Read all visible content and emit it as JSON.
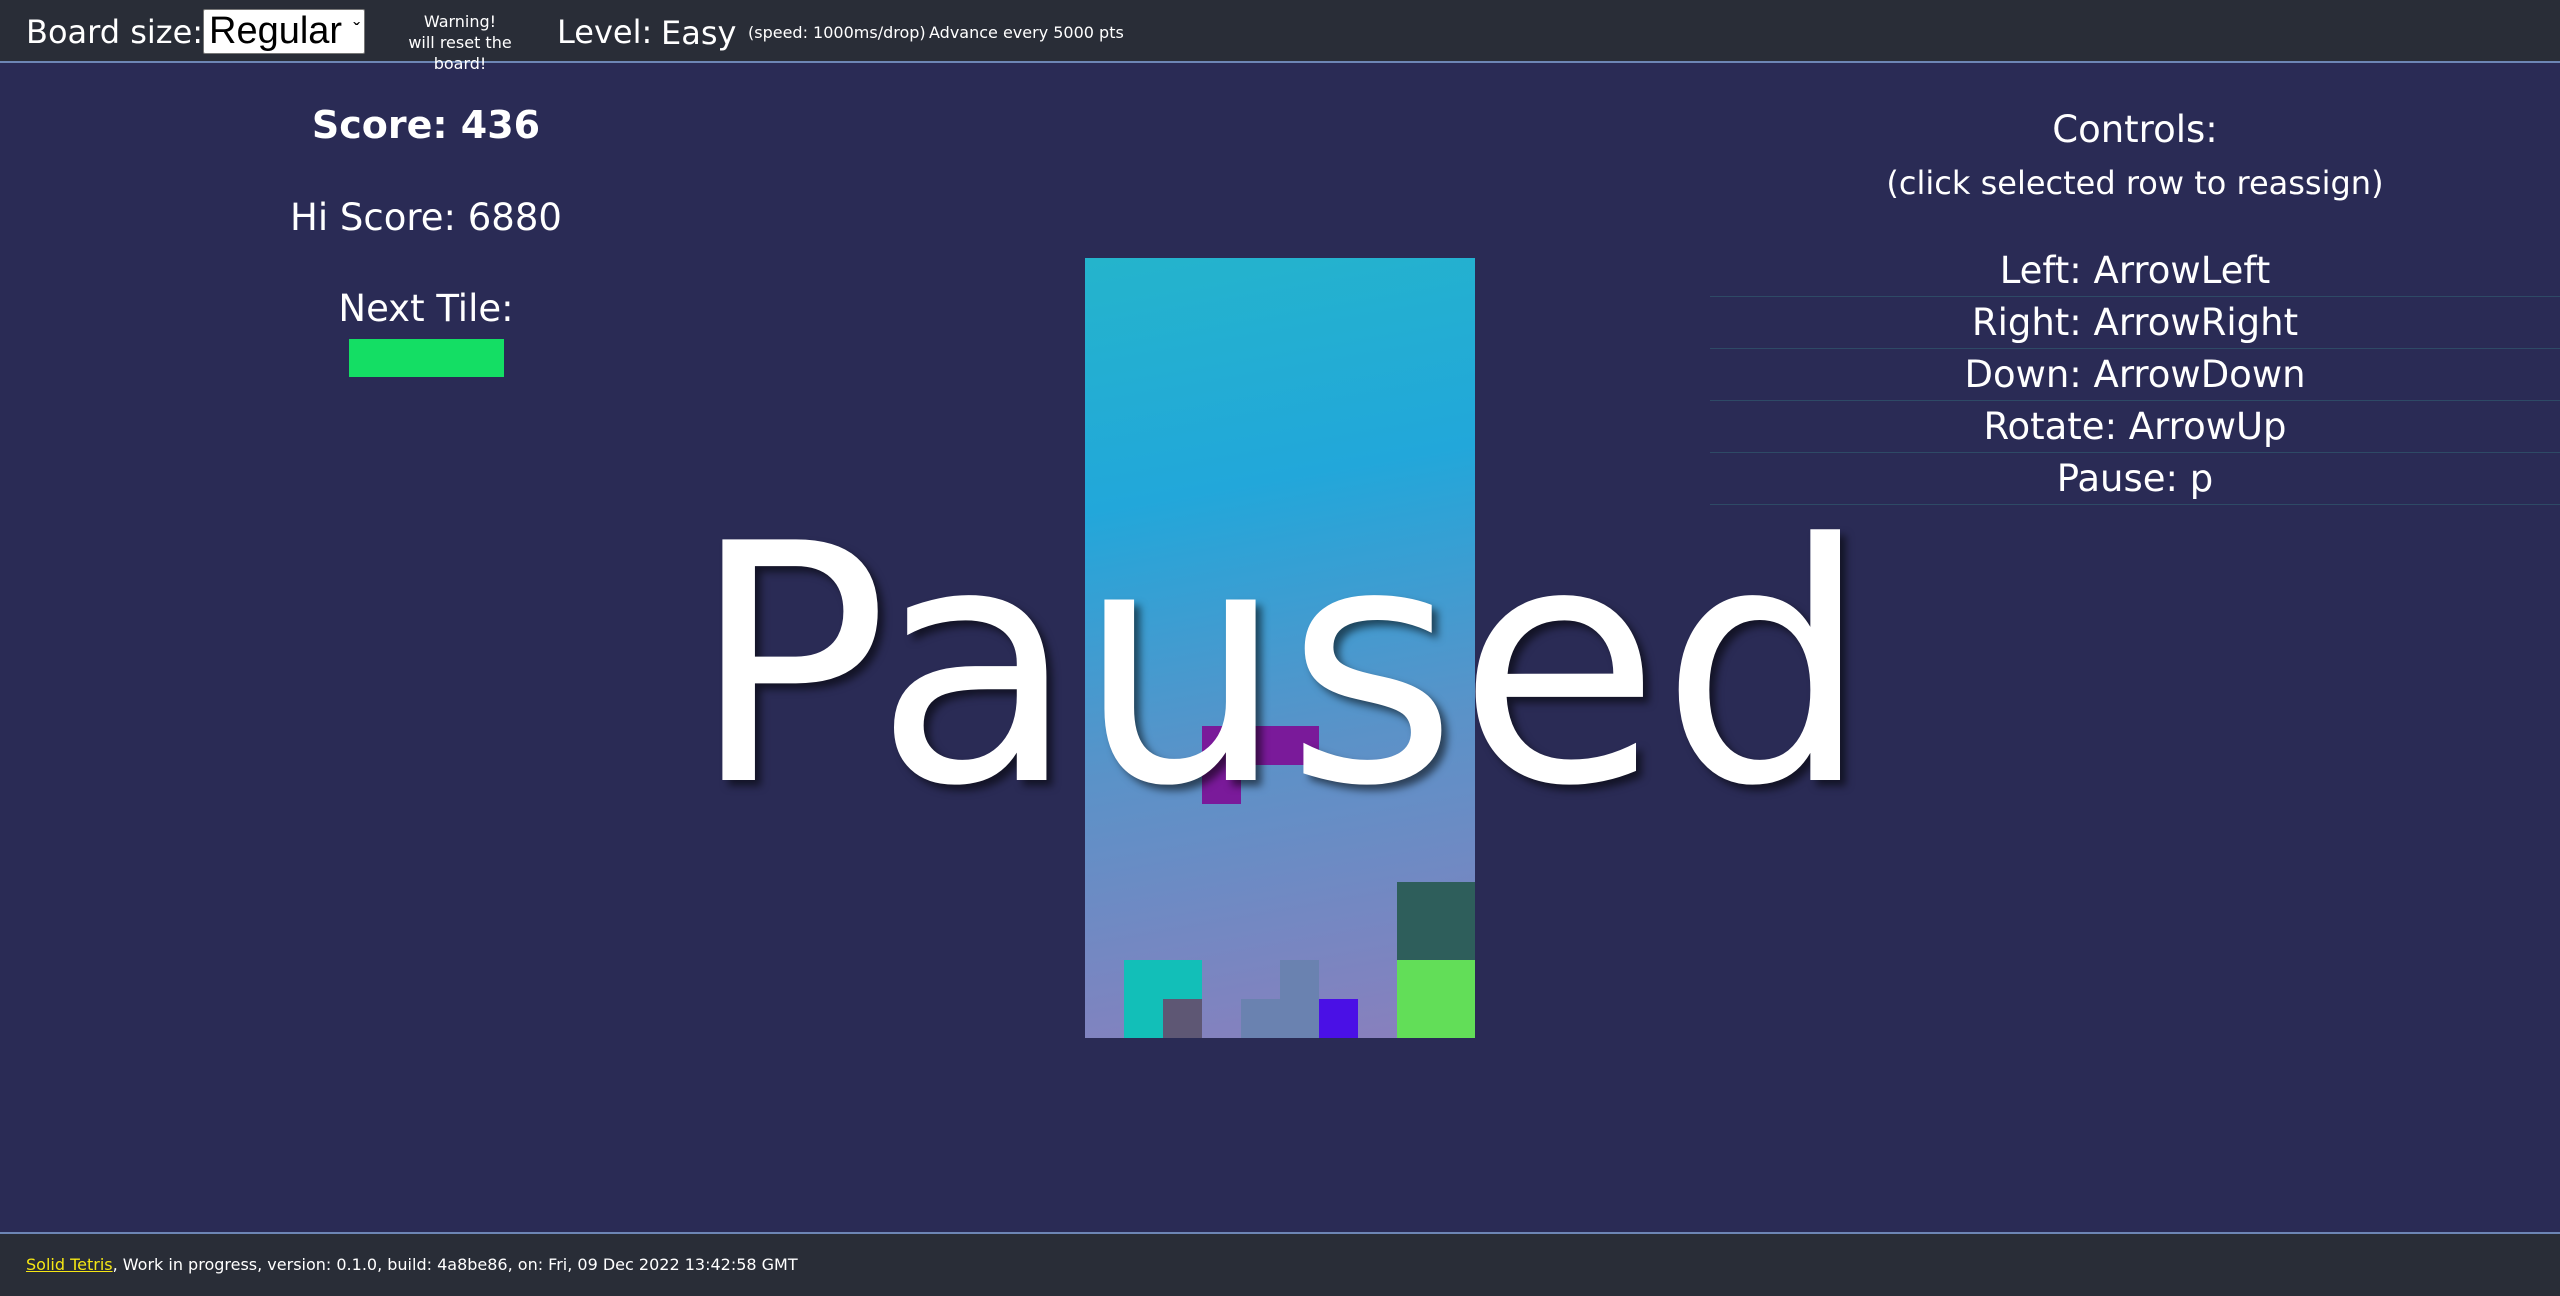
{
  "topbar": {
    "board_size_label": "Board size:",
    "board_size_value": "Regular",
    "warning_line1": "Warning!",
    "warning_line2": "will reset the board!",
    "level_label": "Level:",
    "level_value": "Easy",
    "speed_text": "(speed: 1000ms/drop)",
    "advance_text": "Advance every 5000 pts"
  },
  "stats": {
    "score": "Score: 436",
    "hi_score": "Hi Score: 6880",
    "next_tile_label": "Next Tile:",
    "next_tile_color": "#14de64"
  },
  "board": {
    "columns": 10,
    "rows": 20,
    "overlay_text": "Paused",
    "gradient_colors": [
      "#24b4cc",
      "#22a7da",
      "#5b92c8",
      "#8a7fbd"
    ],
    "cells": [
      {
        "col": 3,
        "row": 12,
        "color": "#7a1a9a"
      },
      {
        "col": 4,
        "row": 12,
        "color": "#7a1a9a"
      },
      {
        "col": 5,
        "row": 12,
        "color": "#7a1a9a"
      },
      {
        "col": 3,
        "row": 13,
        "color": "#7a1a9a"
      },
      {
        "col": 8,
        "row": 16,
        "color": "#2e5e5b"
      },
      {
        "col": 9,
        "row": 16,
        "color": "#2e5e5b"
      },
      {
        "col": 8,
        "row": 17,
        "color": "#2e5e5b"
      },
      {
        "col": 9,
        "row": 17,
        "color": "#2e5e5b"
      },
      {
        "col": 1,
        "row": 18,
        "color": "#12bfb8"
      },
      {
        "col": 2,
        "row": 18,
        "color": "#12bfb8"
      },
      {
        "col": 5,
        "row": 18,
        "color": "#6a82b0"
      },
      {
        "col": 8,
        "row": 18,
        "color": "#62de58"
      },
      {
        "col": 9,
        "row": 18,
        "color": "#62de58"
      },
      {
        "col": 1,
        "row": 19,
        "color": "#12bfb8"
      },
      {
        "col": 2,
        "row": 19,
        "color": "#5e5774"
      },
      {
        "col": 4,
        "row": 19,
        "color": "#6a82b0"
      },
      {
        "col": 5,
        "row": 19,
        "color": "#6a82b0"
      },
      {
        "col": 6,
        "row": 19,
        "color": "#4a10e6"
      },
      {
        "col": 8,
        "row": 19,
        "color": "#62de58"
      },
      {
        "col": 9,
        "row": 19,
        "color": "#62de58"
      }
    ]
  },
  "controls": {
    "title": "Controls:",
    "subtitle": "(click selected row to reassign)",
    "rows": [
      "Left: ArrowLeft",
      "Right: ArrowRight",
      "Down: ArrowDown",
      "Rotate: ArrowUp",
      "Pause: p"
    ]
  },
  "footer": {
    "link_text": "Solid Tetris",
    "rest_text": ", Work in progress, version: 0.1.0, build: 4a8be86, on: Fri, 09 Dec 2022 13:42:58 GMT"
  }
}
